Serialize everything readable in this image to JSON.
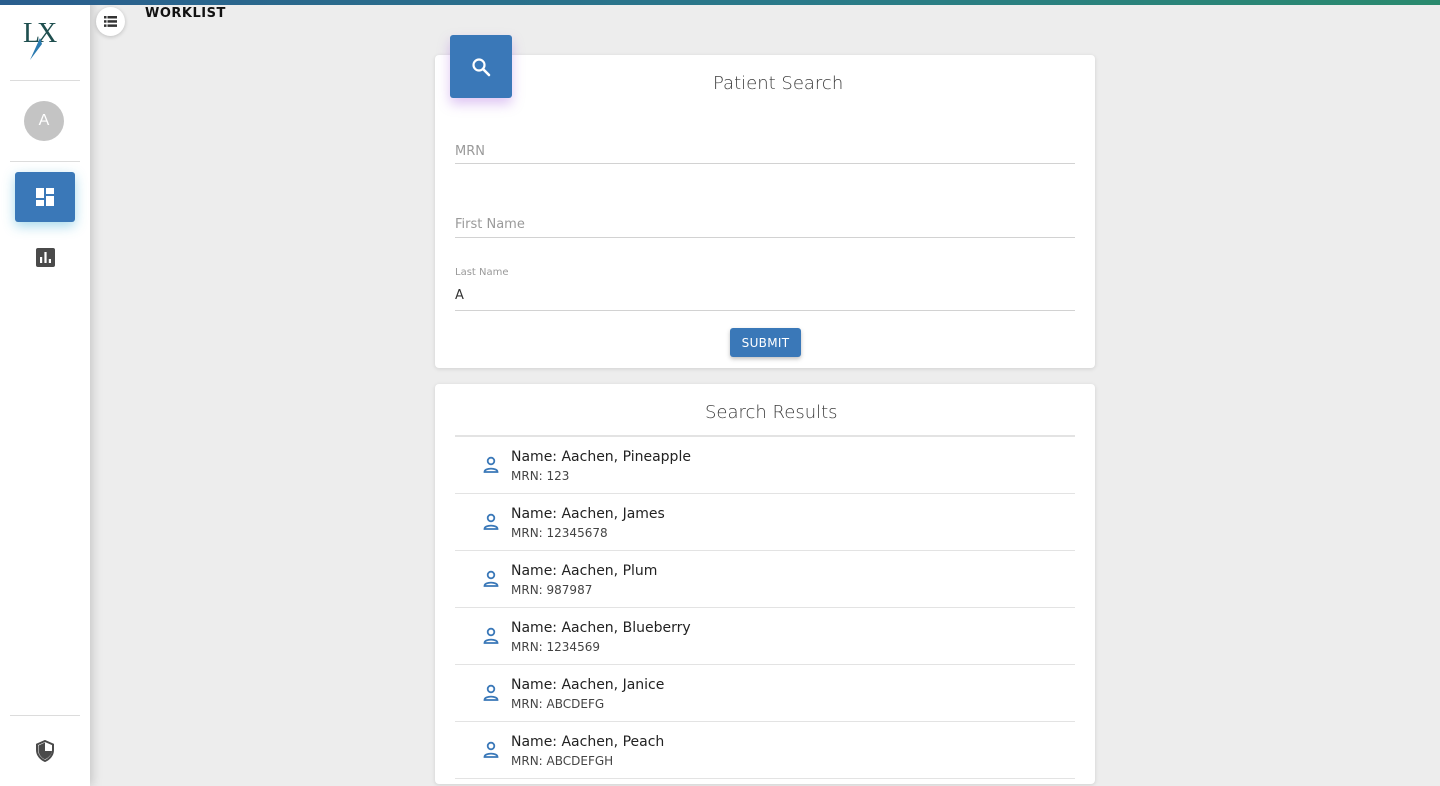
{
  "app": {
    "logo_text": "LX",
    "page_title": "WORKLIST",
    "accent_color": "#3a78b8"
  },
  "sidebar": {
    "avatar_initial": "A",
    "items": [
      {
        "icon": "dashboard-icon",
        "active": true
      },
      {
        "icon": "bar-chart-icon",
        "active": false
      }
    ],
    "footer_icon": "shield-icon"
  },
  "search": {
    "title": "Patient Search",
    "header_icon": "search-icon",
    "mrn_label": "MRN",
    "first_name_label": "First Name",
    "last_name_label": "Last Name",
    "last_name_value": "A",
    "submit_label": "SUBMIT"
  },
  "results": {
    "title": "Search Results",
    "items": [
      {
        "name": "Name: Aachen, Pineapple",
        "mrn": "MRN: 123"
      },
      {
        "name": "Name: Aachen, James",
        "mrn": "MRN: 12345678"
      },
      {
        "name": "Name: Aachen, Plum",
        "mrn": "MRN: 987987"
      },
      {
        "name": "Name: Aachen, Blueberry",
        "mrn": "MRN: 1234569"
      },
      {
        "name": "Name: Aachen, Janice",
        "mrn": "MRN: ABCDEFG"
      },
      {
        "name": "Name: Aachen, Peach",
        "mrn": "MRN: ABCDEFGH"
      }
    ]
  }
}
